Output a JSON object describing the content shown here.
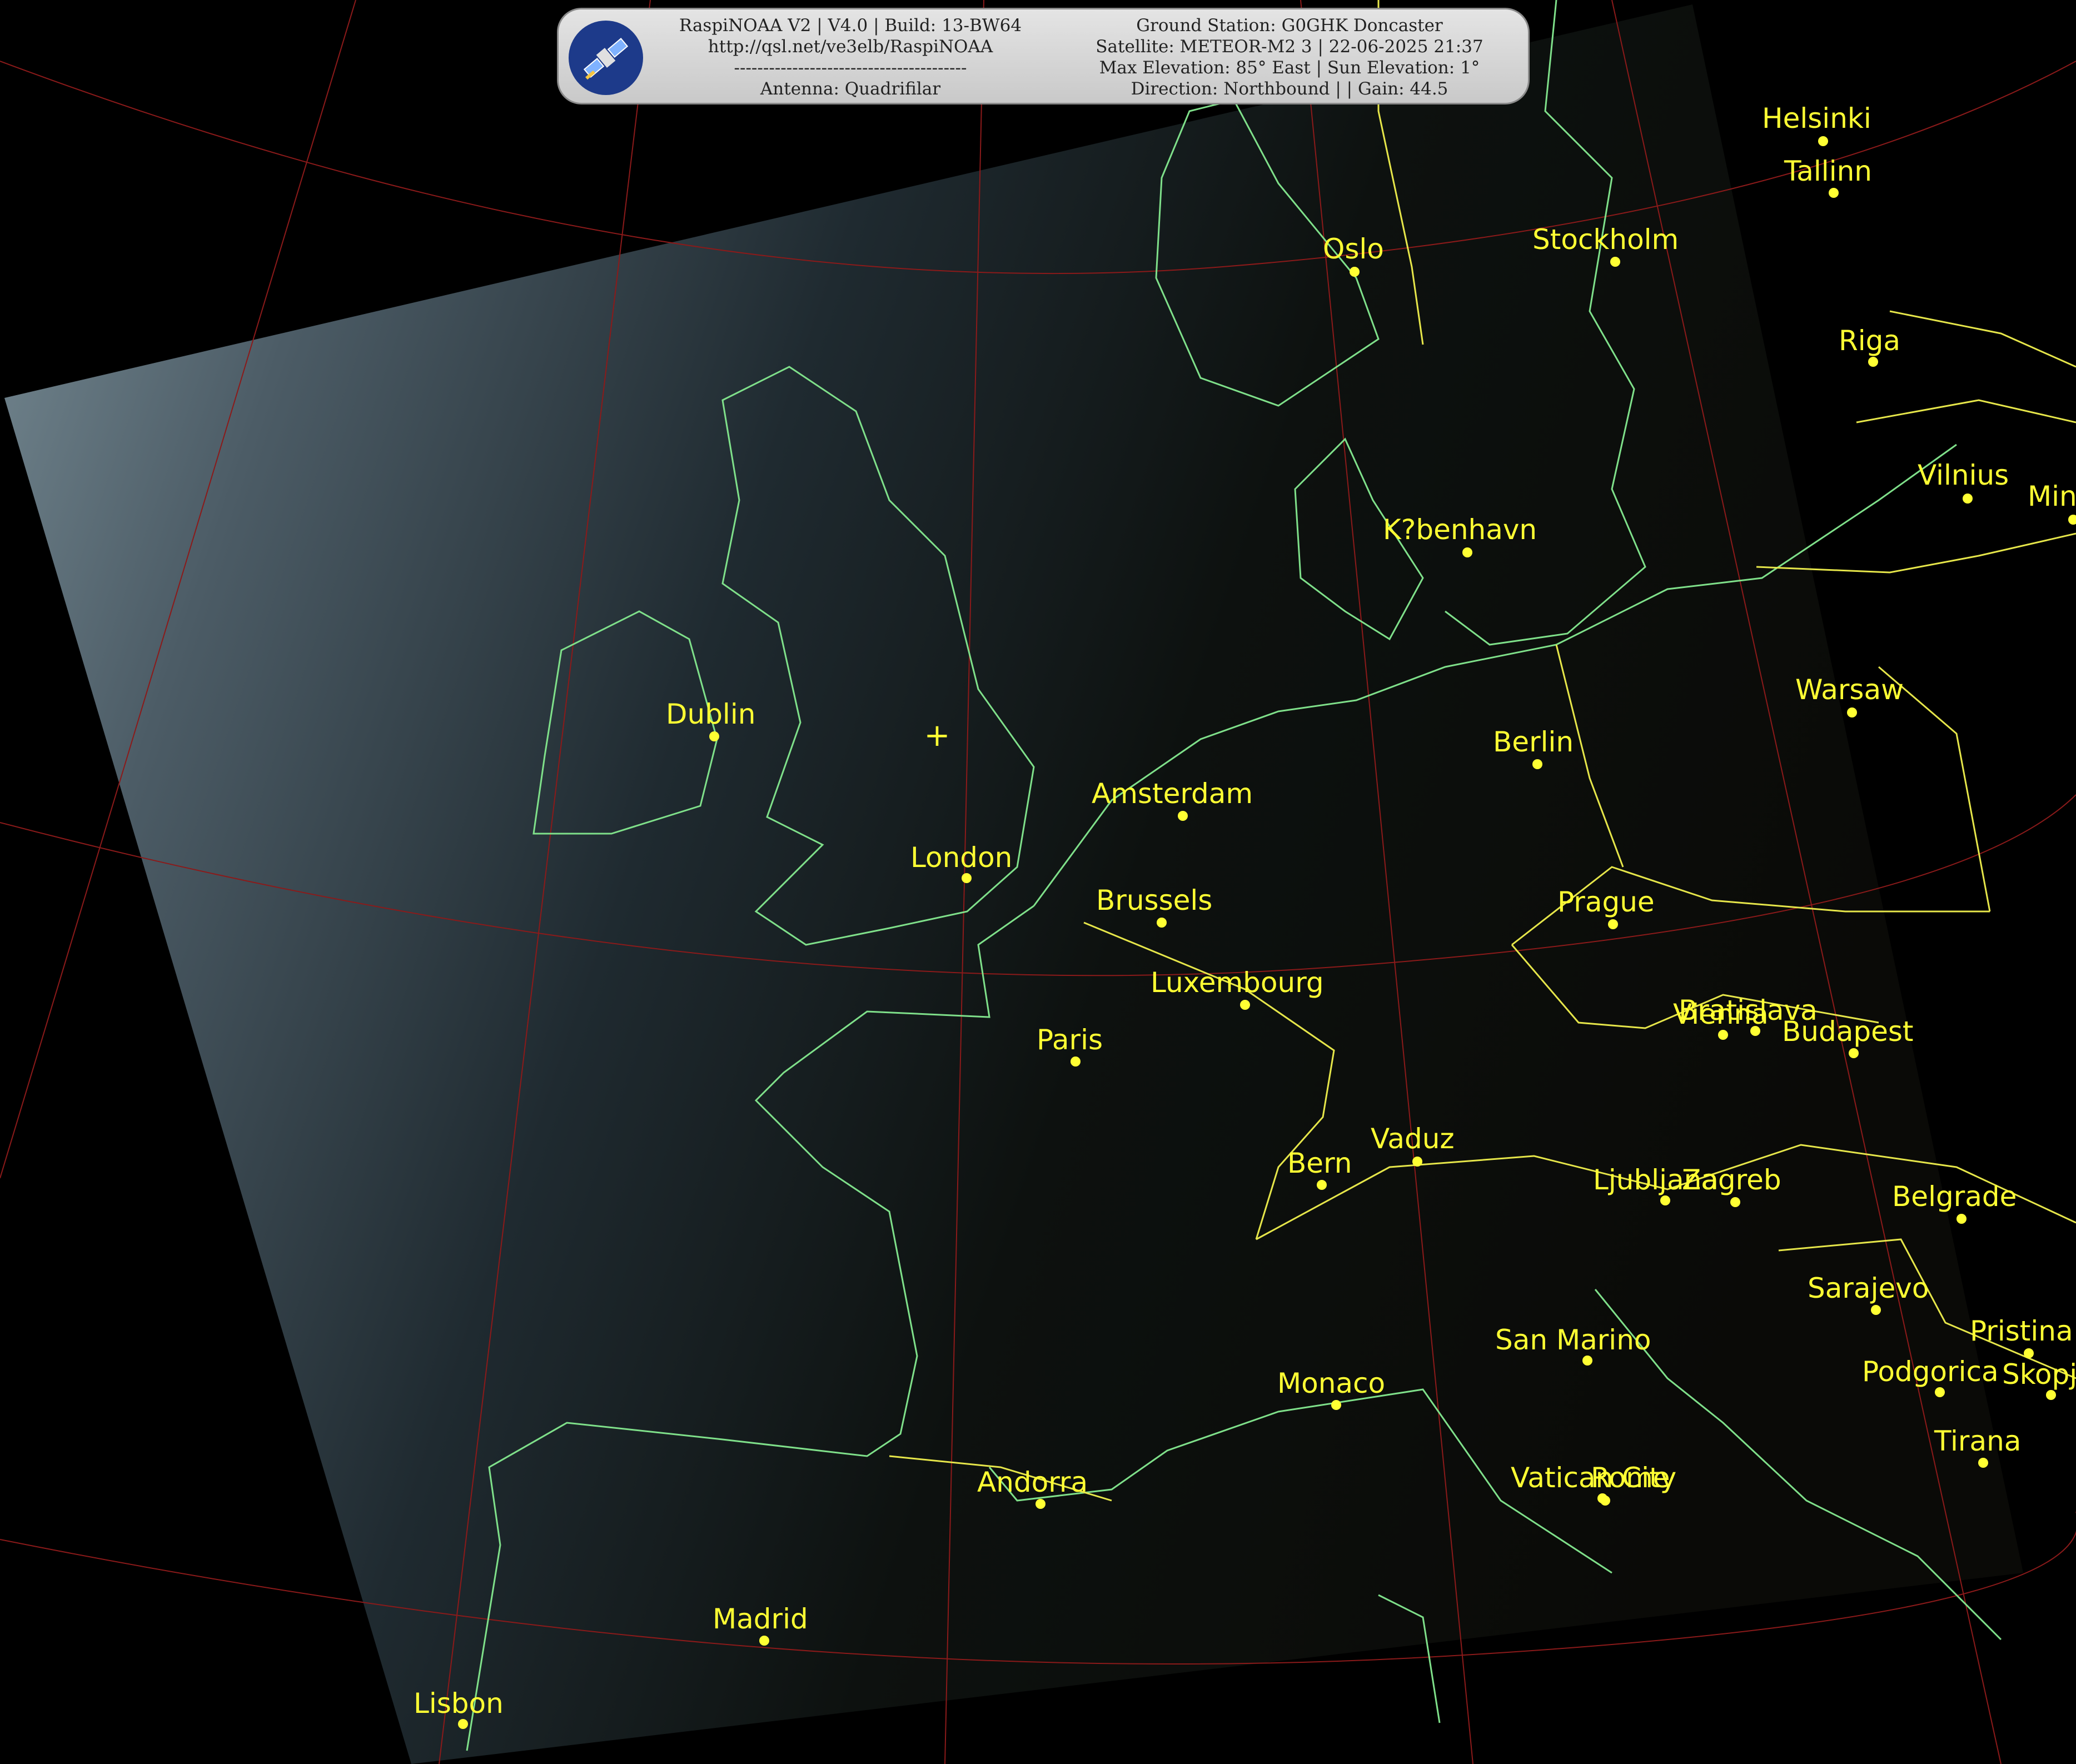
{
  "banner": {
    "left": [
      "RaspiNOAA V2 | V4.0 | Build: 13-BW64",
      "http://qsl.net/ve3elb/RaspiNOAA",
      "----------------------------------------",
      "Antenna: Quadrifilar"
    ],
    "right": [
      "Ground Station: G0GHK Doncaster",
      "Satellite: METEOR-M2 3 | 22-06-2025 21:37",
      "Max Elevation: 85° East | Sun Elevation: 1°",
      "Direction: Northbound | | Gain: 44.5"
    ],
    "logo_icon": "satellite-icon"
  },
  "colors": {
    "coastline": "#7fe08a",
    "border": "#e6e64a",
    "graticule": "#8b1a1a",
    "city": "#ffff33",
    "background": "#000000"
  },
  "cities": [
    {
      "name": "Helsinki"
    },
    {
      "name": "Tallinn"
    },
    {
      "name": "Oslo"
    },
    {
      "name": "Stockholm"
    },
    {
      "name": "Riga"
    },
    {
      "name": "Vilnius"
    },
    {
      "name": "Min"
    },
    {
      "name": "K?benhavn"
    },
    {
      "name": "Dublin"
    },
    {
      "name": "Warsaw"
    },
    {
      "name": "Berlin"
    },
    {
      "name": "Amsterdam"
    },
    {
      "name": "London"
    },
    {
      "name": "Brussels"
    },
    {
      "name": "Prague"
    },
    {
      "name": "Luxembourg"
    },
    {
      "name": "Paris"
    },
    {
      "name": "Bratislava"
    },
    {
      "name": "Vienna"
    },
    {
      "name": "Budapest"
    },
    {
      "name": "Vaduz"
    },
    {
      "name": "Bern"
    },
    {
      "name": "Ljubljana"
    },
    {
      "name": "Zagreb"
    },
    {
      "name": "Belgrade"
    },
    {
      "name": "Sarajevo"
    },
    {
      "name": "San Marino"
    },
    {
      "name": "Pristina"
    },
    {
      "name": "Monaco"
    },
    {
      "name": "Podgorica"
    },
    {
      "name": "Skopje"
    },
    {
      "name": "Tirana"
    },
    {
      "name": "Andorra"
    },
    {
      "name": "Vatican City"
    },
    {
      "name": "Rome"
    },
    {
      "name": "Madrid"
    },
    {
      "name": "Lisbon"
    }
  ],
  "ground_station_marker": "+"
}
